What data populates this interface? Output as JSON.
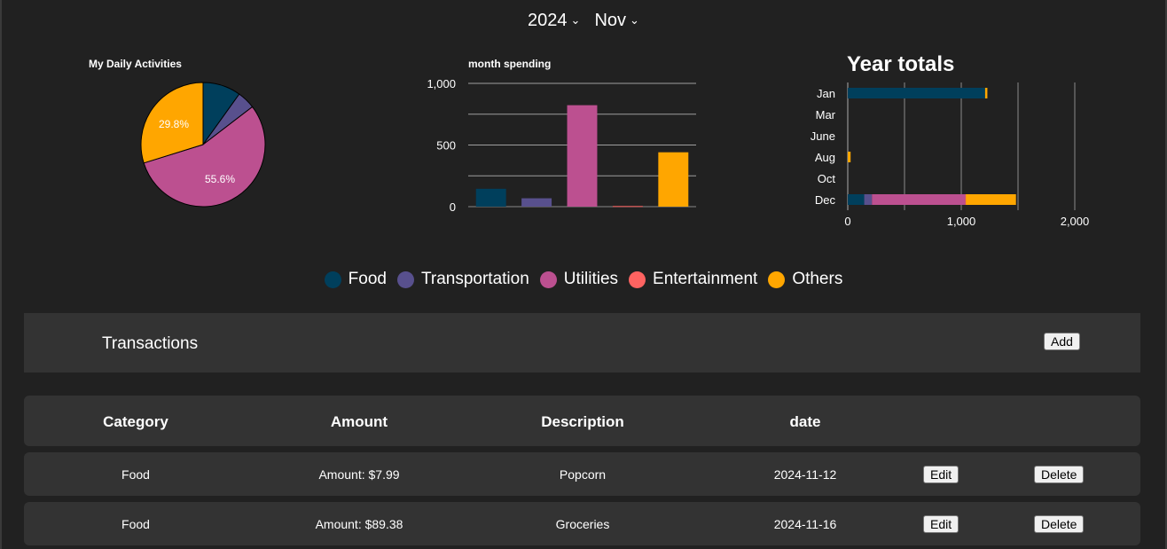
{
  "selectors": {
    "year": "2024",
    "month": "Nov"
  },
  "colors": {
    "Food": "#003f5c",
    "Transportation": "#58508d",
    "Utilities": "#bc5090",
    "Entertainment": "#ff6361",
    "Others": "#ffa600"
  },
  "charts": [
    {
      "type": "pie",
      "title": "My Daily Activities",
      "slices": [
        {
          "name": "Food",
          "value": 9.9
        },
        {
          "name": "Transportation",
          "value": 4.7
        },
        {
          "name": "Utilities",
          "value": 55.6
        },
        {
          "name": "Entertainment",
          "value": 0.0
        },
        {
          "name": "Others",
          "value": 29.8
        }
      ],
      "labels": [
        "55.6%",
        "29.8%"
      ]
    },
    {
      "type": "bar",
      "title": "month spending",
      "categories": [
        "Food",
        "Transportation",
        "Utilities",
        "Entertainment",
        "Others"
      ],
      "values": [
        145,
        68,
        823,
        5,
        441
      ],
      "ylim": [
        0,
        1000
      ],
      "yticks": [
        "0",
        "500",
        "1,000"
      ]
    },
    {
      "type": "bar",
      "orientation": "horizontal-stacked",
      "title": "Year totals",
      "categories": [
        "Jan",
        "Mar",
        "June",
        "Aug",
        "Oct",
        "Dec"
      ],
      "series": [
        {
          "name": "Food",
          "values": [
            1210,
            0,
            0,
            0,
            0,
            145
          ]
        },
        {
          "name": "Transportation",
          "values": [
            0,
            0,
            0,
            0,
            0,
            68
          ]
        },
        {
          "name": "Utilities",
          "values": [
            0,
            0,
            0,
            0,
            0,
            823
          ]
        },
        {
          "name": "Entertainment",
          "values": [
            0,
            0,
            0,
            0,
            0,
            5
          ]
        },
        {
          "name": "Others",
          "values": [
            20,
            0,
            0,
            25,
            0,
            441
          ]
        }
      ],
      "xlim": [
        0,
        2000
      ],
      "xticks": [
        "0",
        "1,000",
        "2,000"
      ]
    }
  ],
  "legend": [
    "Food",
    "Transportation",
    "Utilities",
    "Entertainment",
    "Others"
  ],
  "transactions": {
    "title": "Transactions",
    "add_label": "Add",
    "headers": [
      "Category",
      "Amount",
      "Description",
      "date"
    ],
    "rows": [
      {
        "category": "Food",
        "amount": "Amount: $7.99",
        "description": "Popcorn",
        "date": "2024-11-12"
      },
      {
        "category": "Food",
        "amount": "Amount: $89.38",
        "description": "Groceries",
        "date": "2024-11-16"
      }
    ],
    "edit_label": "Edit",
    "delete_label": "Delete"
  }
}
